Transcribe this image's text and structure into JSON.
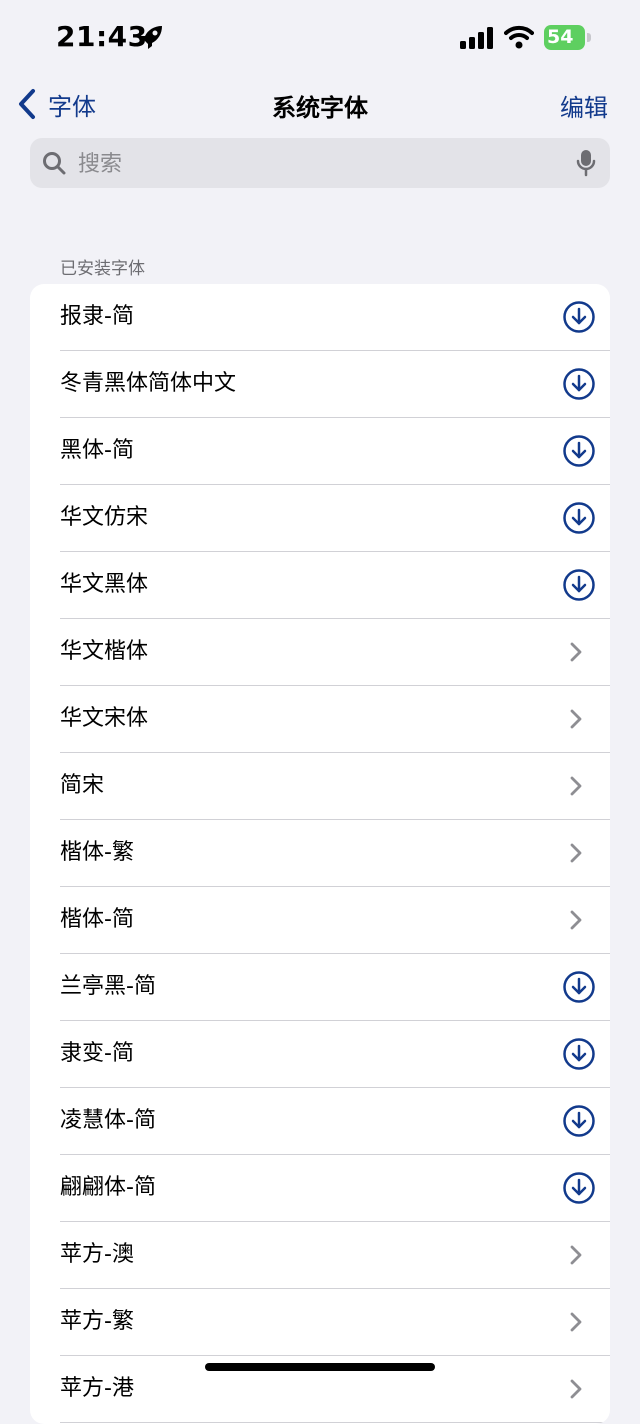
{
  "status": {
    "time": "21:43",
    "battery": "54"
  },
  "nav": {
    "back_label": "字体",
    "title": "系统字体",
    "edit_label": "编辑"
  },
  "search": {
    "placeholder": "搜索"
  },
  "section": {
    "header": "已安装字体"
  },
  "fonts": [
    {
      "label": "报隶-简",
      "action": "download"
    },
    {
      "label": "冬青黑体简体中文",
      "action": "download"
    },
    {
      "label": "黑体-简",
      "action": "download"
    },
    {
      "label": "华文仿宋",
      "action": "download"
    },
    {
      "label": "华文黑体",
      "action": "download"
    },
    {
      "label": "华文楷体",
      "action": "chevron"
    },
    {
      "label": "华文宋体",
      "action": "chevron"
    },
    {
      "label": "简宋",
      "action": "chevron"
    },
    {
      "label": "楷体-繁",
      "action": "chevron"
    },
    {
      "label": "楷体-简",
      "action": "chevron"
    },
    {
      "label": "兰亭黑-简",
      "action": "download"
    },
    {
      "label": "隶变-简",
      "action": "download"
    },
    {
      "label": "凌慧体-简",
      "action": "download"
    },
    {
      "label": "翩翩体-简",
      "action": "download"
    },
    {
      "label": "苹方-澳",
      "action": "chevron"
    },
    {
      "label": "苹方-繁",
      "action": "chevron"
    },
    {
      "label": "苹方-港",
      "action": "chevron"
    }
  ],
  "colors": {
    "accent": "#123a8c",
    "battery": "#5ecf60",
    "background": "#f2f2f7"
  }
}
